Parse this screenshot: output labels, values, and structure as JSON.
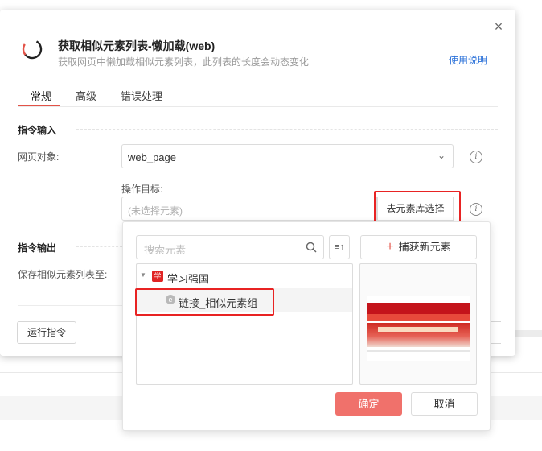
{
  "dialog": {
    "title": "获取相似元素列表-懒加载(web)",
    "subtitle": "获取网页中懒加载相似元素列表，此列表的长度会动态变化",
    "help_link": "使用说明",
    "close_icon": "close-icon"
  },
  "tabs": [
    {
      "label": "常规",
      "active": true
    },
    {
      "label": "高级",
      "active": false
    },
    {
      "label": "错误处理",
      "active": false
    }
  ],
  "input_section": {
    "title": "指令输入",
    "web_object_label": "网页对象:",
    "web_object_value": "web_page",
    "target_label": "操作目标:",
    "target_placeholder": "(未选择元素)",
    "element_library_button": "去元素库选择"
  },
  "output_section": {
    "title": "指令输出",
    "save_label": "保存相似元素列表至:"
  },
  "footer": {
    "run_button": "运行指令"
  },
  "picker": {
    "search_placeholder": "搜索元素",
    "capture_button": "捕获新元素",
    "tree": [
      {
        "label": "学习强国",
        "expanded": true,
        "icon": "site-favicon"
      },
      {
        "label": "链接_相似元素组",
        "selected": true,
        "icon": "element-link-icon"
      }
    ],
    "ok_button": "确定",
    "cancel_button": "取消"
  },
  "colors": {
    "accent": "#e35247",
    "highlight_box": "#e82323",
    "link": "#2c72d9",
    "ok_button": "#f0716b"
  }
}
